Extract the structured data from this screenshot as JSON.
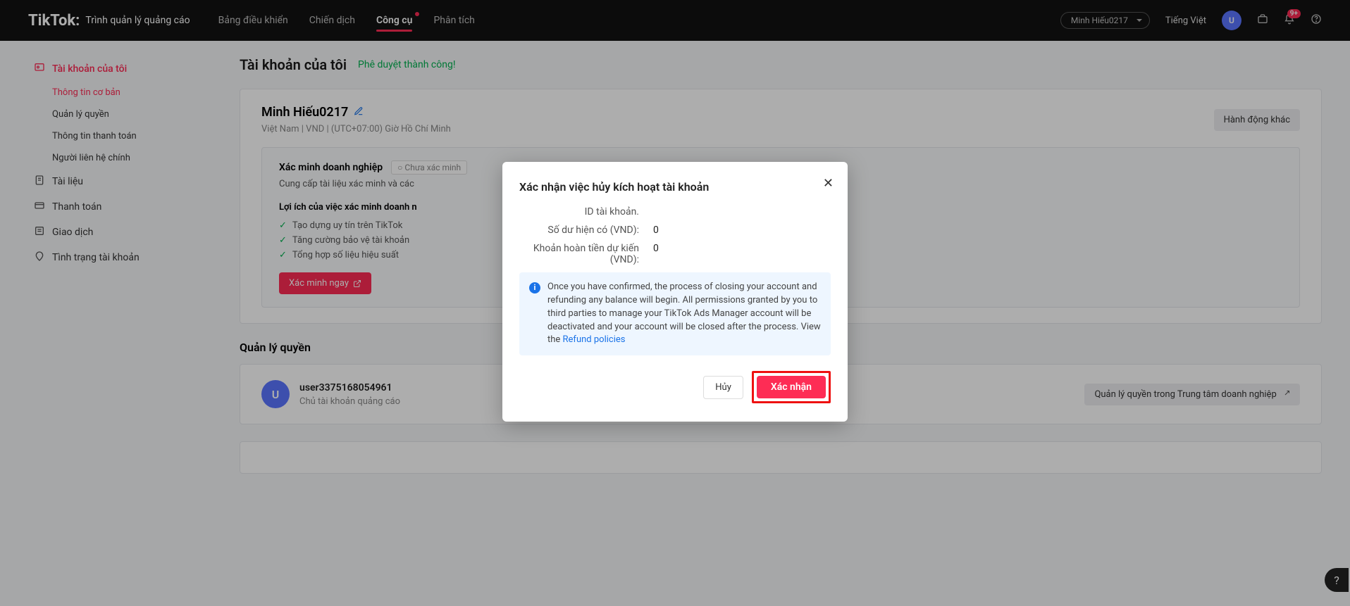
{
  "header": {
    "brand": "TikTok:",
    "brandSub": "Trình quản lý quảng cáo",
    "tabs": [
      "Bảng điều khiển",
      "Chiến dịch",
      "Công cụ",
      "Phân tích"
    ],
    "userName": "Minh Hiếu0217",
    "language": "Tiếng Việt",
    "avatarInitial": "U",
    "bellBadge": "9+"
  },
  "sidebar": {
    "items": [
      {
        "label": "Tài khoản của tôi",
        "active": true
      },
      {
        "subs": [
          {
            "label": "Thông tin cơ bản",
            "active": true
          },
          {
            "label": "Quản lý quyền"
          },
          {
            "label": "Thông tin thanh toán"
          },
          {
            "label": "Người liên hệ chính"
          }
        ]
      },
      {
        "label": "Tài liệu"
      },
      {
        "label": "Thanh toán"
      },
      {
        "label": "Giao dịch"
      },
      {
        "label": "Tình trạng tài khoản"
      }
    ]
  },
  "page": {
    "title": "Tài khoản của tôi",
    "status": "Phê duyệt thành công!",
    "account": {
      "name": "Minh Hiếu0217",
      "meta": "Việt Nam | VND | (UTC+07:00) Giờ Hồ Chí Minh",
      "otherActions": "Hành động khác"
    },
    "verify": {
      "title": "Xác minh doanh nghiệp",
      "statusChip": "Chưa xác minh",
      "desc": "Cung cấp tài liệu xác minh và các",
      "benefitHead": "Lợi ích của việc xác minh doanh n",
      "benefits": [
        "Tạo dựng uy tín trên TikTok",
        "Tăng cường bảo vệ tài khoản",
        "Tổng hợp số liệu hiệu suất"
      ],
      "cta": "Xác minh ngay"
    },
    "perm": {
      "title": "Quản lý quyền",
      "userId": "user3375168054961",
      "role": "Chủ tài khoản quảng cáo",
      "centerLink": "Quản lý quyền trong Trung tâm doanh nghiệp"
    }
  },
  "modal": {
    "title": "Xác nhận việc hủy kích hoạt tài khoản",
    "rows": [
      {
        "label": "ID tài khoản.",
        "value": ""
      },
      {
        "label": "Số dư hiện có (VND):",
        "value": "0"
      },
      {
        "label": "Khoản hoàn tiền dự kiến (VND):",
        "value": "0"
      }
    ],
    "info": "Once you have confirmed, the process of closing your account and refunding any balance will begin. All permissions granted by you to third parties to manage your TikTok Ads Manager account will be deactivated and your account will be closed after the process. View the ",
    "infoLink": "Refund policies",
    "cancel": "Hủy",
    "confirm": "Xác nhận"
  },
  "avatarInitial": "U"
}
